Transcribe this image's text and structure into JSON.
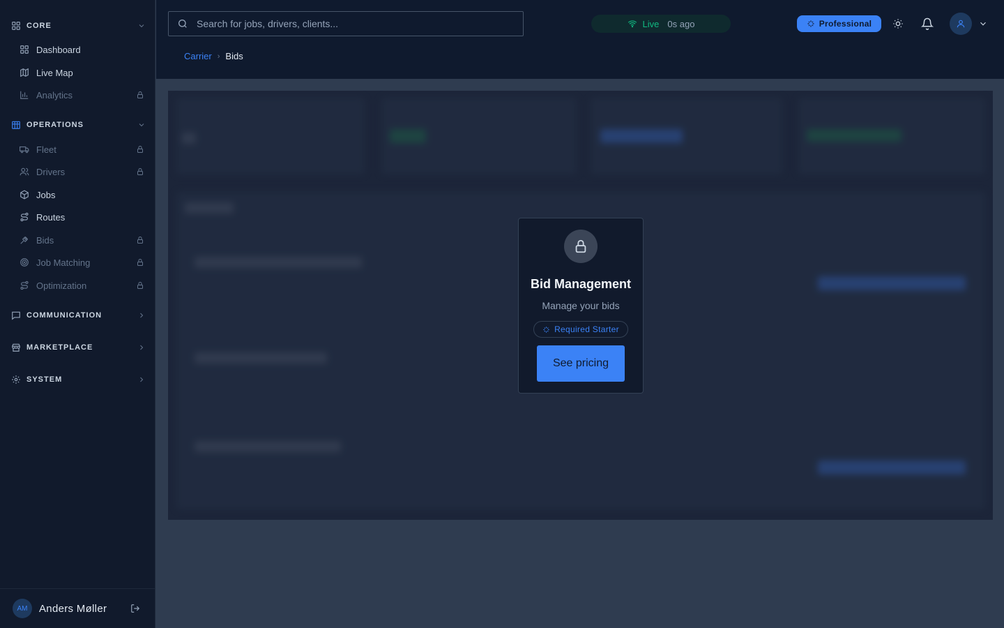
{
  "sidebar": {
    "sections": {
      "core": "CORE",
      "operations": "OPERATIONS",
      "communication": "COMMUNICATION",
      "marketplace": "MARKETPLACE",
      "system": "SYSTEM"
    },
    "core_items": {
      "dashboard": "Dashboard",
      "live_map": "Live Map",
      "analytics": "Analytics"
    },
    "operations_items": {
      "fleet": "Fleet",
      "drivers": "Drivers",
      "jobs": "Jobs",
      "routes": "Routes",
      "bids": "Bids",
      "job_matching": "Job Matching",
      "optimization": "Optimization"
    },
    "user": {
      "initials": "AM",
      "name": "Anders Møller"
    }
  },
  "header": {
    "search_placeholder": "Search for jobs, drivers, clients...",
    "live_label": "Live",
    "last_update": "0s ago",
    "plan": "Professional"
  },
  "breadcrumb": {
    "parent": "Carrier",
    "current": "Bids"
  },
  "lock_card": {
    "title": "Bid Management",
    "subtitle": "Manage your bids",
    "required": "Required Starter",
    "button": "See pricing"
  },
  "colors": {
    "accent": "#3b82f6",
    "live": "#10b981",
    "sidebar_bg": "#111a2c"
  }
}
